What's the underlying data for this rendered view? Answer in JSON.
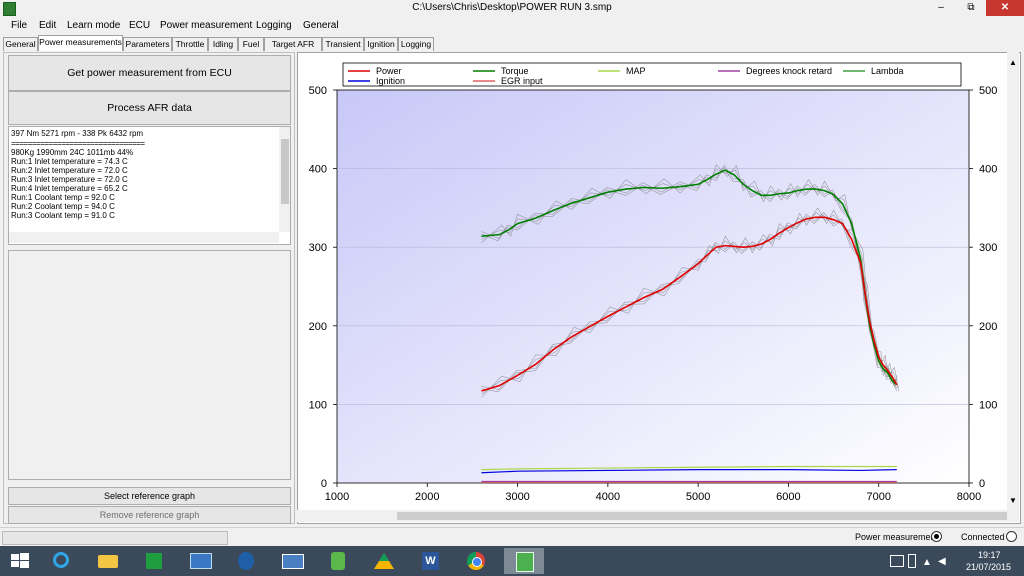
{
  "window": {
    "title": "C:\\Users\\Chris\\Desktop\\POWER RUN 3.smp",
    "minimize_glyph": "–",
    "maximize_glyph": "⧉",
    "close_glyph": "✕"
  },
  "menu": [
    "File",
    "Edit",
    "Learn mode",
    "ECU",
    "Power measurement",
    "Logging",
    "General"
  ],
  "tabs": [
    "General",
    "Power measurements",
    "Parameters",
    "Throttle",
    "Idling",
    "Fuel",
    "Target AFR",
    "Transient",
    "Ignition",
    "Logging"
  ],
  "active_tab": "Power measurements",
  "left": {
    "get_power_button": "Get power measurement from ECU",
    "process_afr_button": "Process AFR data",
    "log_lines": [
      "397 Nm 5271 rpm - 338 Pk 6432 rpm",
      "================================",
      "980Kg 1990mm 24C 1011mb 44%",
      "Run:1 Inlet temperature = 74.3 C",
      "Run:2 Inlet temperature = 72.0 C",
      "Run:3 Inlet temperature = 72.0 C",
      "Run:4 Inlet temperature = 65.2 C",
      "Run:1 Coolant temp = 92.0 C",
      "Run:2 Coolant temp = 94.0 C",
      "Run:3 Coolant temp = 91.0 C"
    ],
    "select_ref_button": "Select reference graph",
    "remove_ref_button": "Remove reference graph"
  },
  "status": {
    "power_measurement_label": "Power measurement",
    "connected_label": "Connected",
    "power_measurement_selected": true,
    "connected_selected": false
  },
  "taskbar": {
    "time": "19:17",
    "date": "21/07/2015",
    "apps": [
      "windows-start-icon",
      "internet-explorer-icon",
      "file-explorer-icon",
      "store-icon",
      "remote-desktop-icon",
      "calculator-icon",
      "messaging-icon",
      "evernote-icon",
      "google-drive-icon",
      "word-icon",
      "chrome-icon",
      "ecu-tuner-app-icon"
    ]
  },
  "chart_data": {
    "type": "line",
    "title": "",
    "xlabel": "",
    "ylabel": "",
    "xlim": [
      1000,
      8000
    ],
    "ylim": [
      0,
      500
    ],
    "x_ticks": [
      1000,
      2000,
      3000,
      4000,
      5000,
      6000,
      7000,
      8000
    ],
    "y_ticks": [
      0,
      100,
      200,
      300,
      400,
      500
    ],
    "grid": true,
    "legend_position": "top",
    "legend": [
      {
        "name": "Power",
        "color": "#e00000"
      },
      {
        "name": "Torque",
        "color": "#008000"
      },
      {
        "name": "MAP",
        "color": "#a8d84a"
      },
      {
        "name": "Degrees knock retard",
        "color": "#a040a0"
      },
      {
        "name": "Lambda",
        "color": "#40a040"
      },
      {
        "name": "Ignition",
        "color": "#0000e0"
      },
      {
        "name": "EGR input",
        "color": "#e06060"
      }
    ],
    "series": [
      {
        "name": "Torque",
        "color": "#008000",
        "x": [
          2600,
          2800,
          2900,
          3000,
          3200,
          3400,
          3600,
          3800,
          4000,
          4200,
          4400,
          4600,
          4800,
          5000,
          5100,
          5200,
          5300,
          5400,
          5500,
          5600,
          5700,
          5800,
          5900,
          6000,
          6100,
          6200,
          6300,
          6400,
          6500,
          6600,
          6700,
          6800,
          6850,
          6900,
          6950,
          7000,
          7050,
          7100,
          7150,
          7200
        ],
        "y": [
          314,
          316,
          322,
          330,
          337,
          347,
          356,
          363,
          370,
          374,
          376,
          375,
          377,
          380,
          386,
          393,
          398,
          392,
          380,
          372,
          366,
          366,
          368,
          369,
          372,
          374,
          374,
          372,
          367,
          355,
          330,
          285,
          240,
          200,
          175,
          155,
          145,
          140,
          130,
          125
        ]
      },
      {
        "name": "Power",
        "color": "#e00000",
        "x": [
          2600,
          2800,
          3000,
          3200,
          3400,
          3600,
          3800,
          4000,
          4200,
          4400,
          4600,
          4800,
          5000,
          5100,
          5200,
          5300,
          5400,
          5500,
          5600,
          5700,
          5800,
          5900,
          6000,
          6100,
          6200,
          6300,
          6400,
          6500,
          6600,
          6700,
          6800,
          6850,
          6900,
          6950,
          7000,
          7050,
          7100,
          7150,
          7200
        ],
        "y": [
          117,
          124,
          137,
          151,
          170,
          186,
          199,
          212,
          224,
          236,
          246,
          262,
          279,
          290,
          300,
          302,
          301,
          300,
          301,
          304,
          310,
          318,
          325,
          331,
          336,
          338,
          338,
          335,
          330,
          310,
          280,
          240,
          205,
          180,
          160,
          150,
          143,
          135,
          125
        ]
      },
      {
        "name": "MAP",
        "color": "#a8d84a",
        "x": [
          2600,
          3000,
          4000,
          5000,
          6000,
          7000,
          7200
        ],
        "y": [
          17,
          18,
          19,
          20,
          21,
          21,
          21
        ]
      },
      {
        "name": "Ignition",
        "color": "#0000e0",
        "x": [
          2600,
          3000,
          4000,
          5000,
          6000,
          6800,
          7200
        ],
        "y": [
          13,
          15,
          16,
          17,
          17,
          16,
          17
        ]
      },
      {
        "name": "EGR input",
        "color": "#e06060",
        "x": [
          2600,
          3000,
          4000,
          5000,
          6000,
          7000,
          7200
        ],
        "y": [
          1,
          1,
          1,
          1,
          1,
          1,
          1
        ]
      },
      {
        "name": "Degrees knock retard",
        "color": "#a040a0",
        "x": [
          2600,
          3000,
          4000,
          5000,
          6000,
          7000,
          7200
        ],
        "y": [
          2,
          2,
          2,
          2,
          2,
          2,
          2
        ]
      }
    ]
  }
}
